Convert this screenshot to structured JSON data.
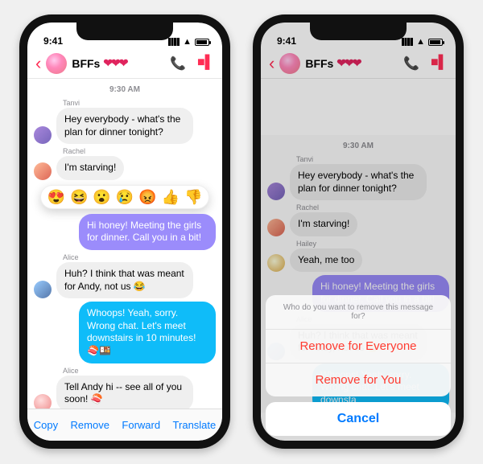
{
  "status": {
    "time": "9:41"
  },
  "header": {
    "chat_name": "BFFs",
    "hearts": "❤❤❤"
  },
  "timestamp": "9:30 AM",
  "senders": {
    "tanvi": "Tanvi",
    "rachel": "Rachel",
    "hailey": "Hailey",
    "alice": "Alice"
  },
  "messages": {
    "tanvi": "Hey everybody - what's the plan for dinner tonight?",
    "rachel": "I'm starving!",
    "hailey": "Yeah, me too",
    "me_purple": "Hi honey! Meeting the girls for dinner. Call you in a bit!",
    "alice1": "Huh? I think that was meant for Andy, not us 😂",
    "me_blue_left": "Whoops! Yeah, sorry. Wrong chat. Let's meet downstairs in 10 minutes! 🍣🍱",
    "me_blue_right": "Whoops! Yeah, sorry. Wrong chat. Let's meet downsta",
    "alice2": "Tell Andy hi -- see all of you soon! 🍣"
  },
  "reactions": [
    "😍",
    "😆",
    "😮",
    "😢",
    "😡",
    "👍",
    "👎"
  ],
  "actionbar": {
    "copy": "Copy",
    "remove": "Remove",
    "forward": "Forward",
    "translate": "Translate"
  },
  "sheet": {
    "prompt": "Who do you want to remove this message for?",
    "remove_everyone": "Remove for Everyone",
    "remove_you": "Remove for You",
    "cancel": "Cancel"
  }
}
